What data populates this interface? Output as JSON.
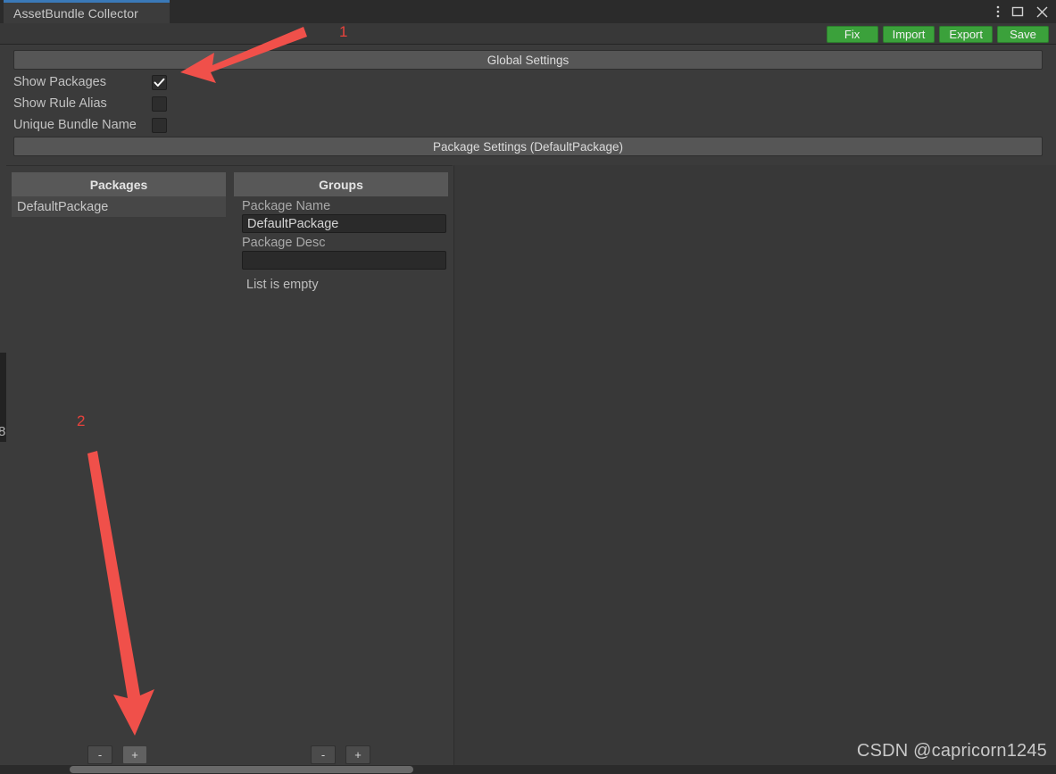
{
  "window": {
    "tab_label": "AssetBundle Collector",
    "controls": [
      {
        "name": "more-options-icon",
        "glyph": "vertical-dots"
      },
      {
        "name": "maximize-icon",
        "glyph": "square"
      },
      {
        "name": "close-icon",
        "glyph": "cross"
      }
    ]
  },
  "toolbar": {
    "buttons": [
      {
        "label": "Fix",
        "name": "fix-button"
      },
      {
        "label": "Import",
        "name": "import-button"
      },
      {
        "label": "Export",
        "name": "export-button"
      },
      {
        "label": "Save",
        "name": "save-button"
      }
    ],
    "button_color": "#3ba13b"
  },
  "global_settings": {
    "header": "Global Settings",
    "options": [
      {
        "label": "Show Packages",
        "checked": true
      },
      {
        "label": "Show Rule Alias",
        "checked": false
      },
      {
        "label": "Unique Bundle Name",
        "checked": false
      }
    ]
  },
  "package_settings": {
    "header": "Package Settings (DefaultPackage)"
  },
  "packages_panel": {
    "title": "Packages",
    "items": [
      {
        "label": "DefaultPackage",
        "selected": true
      }
    ],
    "remove_button": "-",
    "add_button": "+"
  },
  "groups_panel": {
    "title": "Groups",
    "fields": [
      {
        "label": "Package Name",
        "value": "DefaultPackage",
        "placeholder": ""
      },
      {
        "label": "Package Desc",
        "value": "",
        "placeholder": ""
      }
    ],
    "empty_message": "List is empty",
    "remove_button": "-",
    "add_button": "+"
  },
  "annotations": [
    {
      "number": "1",
      "target": "show-packages-checkbox",
      "color": "#f0504a"
    },
    {
      "number": "2",
      "target": "packages-add-button",
      "color": "#f0504a"
    }
  ],
  "watermark": "CSDN @capricorn1245",
  "left_strip_glyph": "8"
}
